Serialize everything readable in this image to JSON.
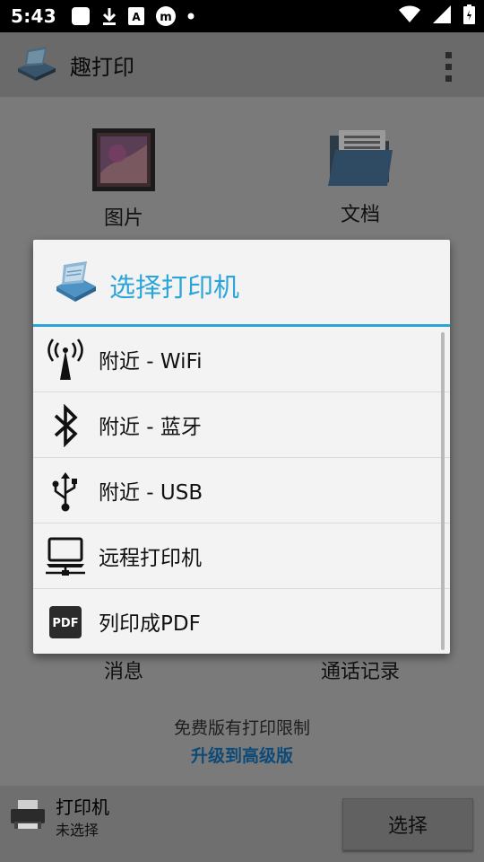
{
  "status_bar": {
    "time": "5:43",
    "icons": [
      "square-notification-icon",
      "download-icon",
      "a-badge-icon",
      "m-badge-icon",
      "dot-icon",
      "wifi-icon",
      "signal-icon",
      "battery-icon"
    ]
  },
  "app_bar": {
    "title": "趣打印",
    "menu_icon": "overflow-menu-icon"
  },
  "home_tiles": {
    "photos": "图片",
    "documents": "文档",
    "messages": "消息",
    "call_log": "通话记录"
  },
  "promo": {
    "line1": "免费版有打印限制",
    "line2": "升级到高级版"
  },
  "bottom_bar": {
    "printer_title": "打印机",
    "printer_status": "未选择",
    "select_button": "选择"
  },
  "dialog": {
    "title": "选择打印机",
    "accent_color": "#2aa5d8",
    "options": [
      {
        "icon": "wifi-antenna-icon",
        "label": "附近 - WiFi"
      },
      {
        "icon": "bluetooth-icon",
        "label": "附近 - 蓝牙"
      },
      {
        "icon": "usb-icon",
        "label": "附近 - USB"
      },
      {
        "icon": "remote-computer-icon",
        "label": "远程打印机"
      },
      {
        "icon": "pdf-icon",
        "label": "列印成PDF"
      }
    ]
  }
}
